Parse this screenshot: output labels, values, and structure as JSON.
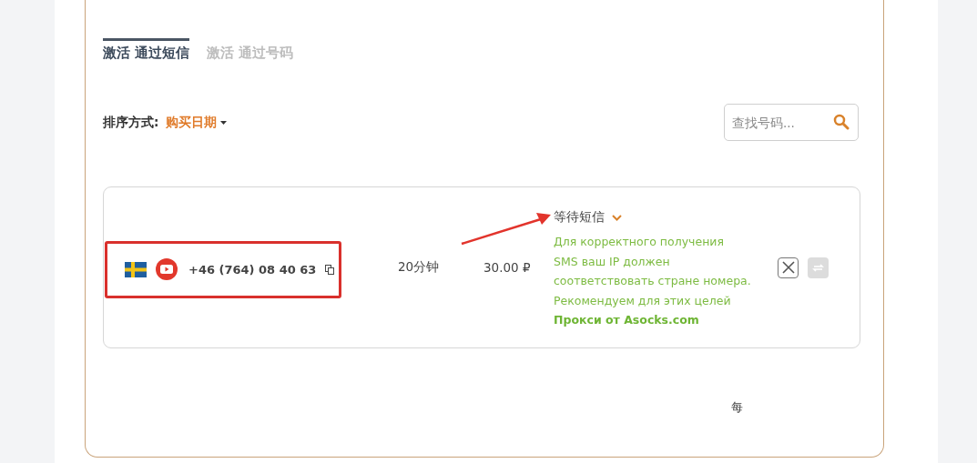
{
  "tabs": [
    {
      "label": "激活 通过短信",
      "selected": true
    },
    {
      "label": "激活 通过号码",
      "selected": false
    }
  ],
  "sort": {
    "label": "排序方式:",
    "value": "购买日期"
  },
  "search": {
    "placeholder": "查找号码..."
  },
  "orders": [
    {
      "phone": "+46 (764) 08 40 63",
      "duration": "20分钟",
      "price": "30.00 ₽",
      "status": "等待短信",
      "note_lines": [
        "Для корректного получения",
        "SMS ваш IP должен",
        "соответствовать стране номера.",
        "Рекомендуем для этих целей"
      ],
      "link": "Прокси от Asocks.com",
      "highlighted": true,
      "refresh_disabled": true
    }
  ],
  "footer": {
    "text": "每"
  }
}
